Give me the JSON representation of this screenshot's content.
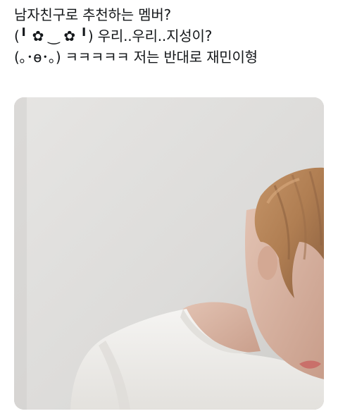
{
  "tweet": {
    "lines": [
      "남자친구로 추천하는 멤버?",
      "(╹ ✿ ‿ ✿ ╹) 우리..우리..지성이?",
      "(｡･ө･｡) ㅋㅋㅋㅋㅋ 저는 반대로 재민이형"
    ]
  },
  "media": {
    "type": "photo",
    "subject": "person-with-light-hair-in-white-tshirt",
    "colors": {
      "wall_light": "#e4e3e1",
      "wall_dark": "#cfcecb",
      "hair": "#b8875a",
      "hair_shadow": "#8d6241",
      "skin": "#d9b7a6",
      "shirt": "#f3f2f0",
      "shirt_shadow": "#dcdad6"
    }
  }
}
